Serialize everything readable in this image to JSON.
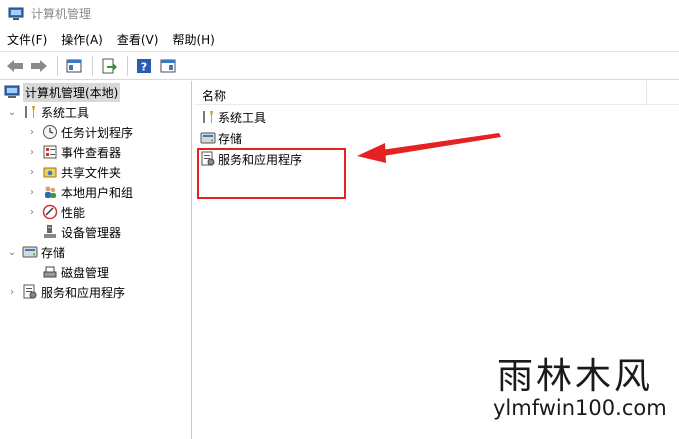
{
  "window": {
    "title": "计算机管理"
  },
  "menu": [
    "文件(F)",
    "操作(A)",
    "查看(V)",
    "帮助(H)"
  ],
  "toolbar": {
    "buttons": [
      "back-icon",
      "forward-icon",
      "show-hide-tree-icon",
      "export-list-icon",
      "help-icon",
      "show-hide-action-pane-icon"
    ]
  },
  "tree": {
    "root": "计算机管理(本地)",
    "system_tools": "系统工具",
    "task_scheduler": "任务计划程序",
    "event_viewer": "事件查看器",
    "shared_folders": "共享文件夹",
    "local_users": "本地用户和组",
    "performance": "性能",
    "device_manager": "设备管理器",
    "storage": "存储",
    "disk_management": "磁盘管理",
    "services_apps": "服务和应用程序"
  },
  "list": {
    "column_name": "名称",
    "items": [
      "系统工具",
      "存储",
      "服务和应用程序"
    ]
  },
  "annotation": {
    "color": "#e52222"
  },
  "watermark": {
    "cn": "雨林木风",
    "en": "ylmfwin100.com"
  }
}
